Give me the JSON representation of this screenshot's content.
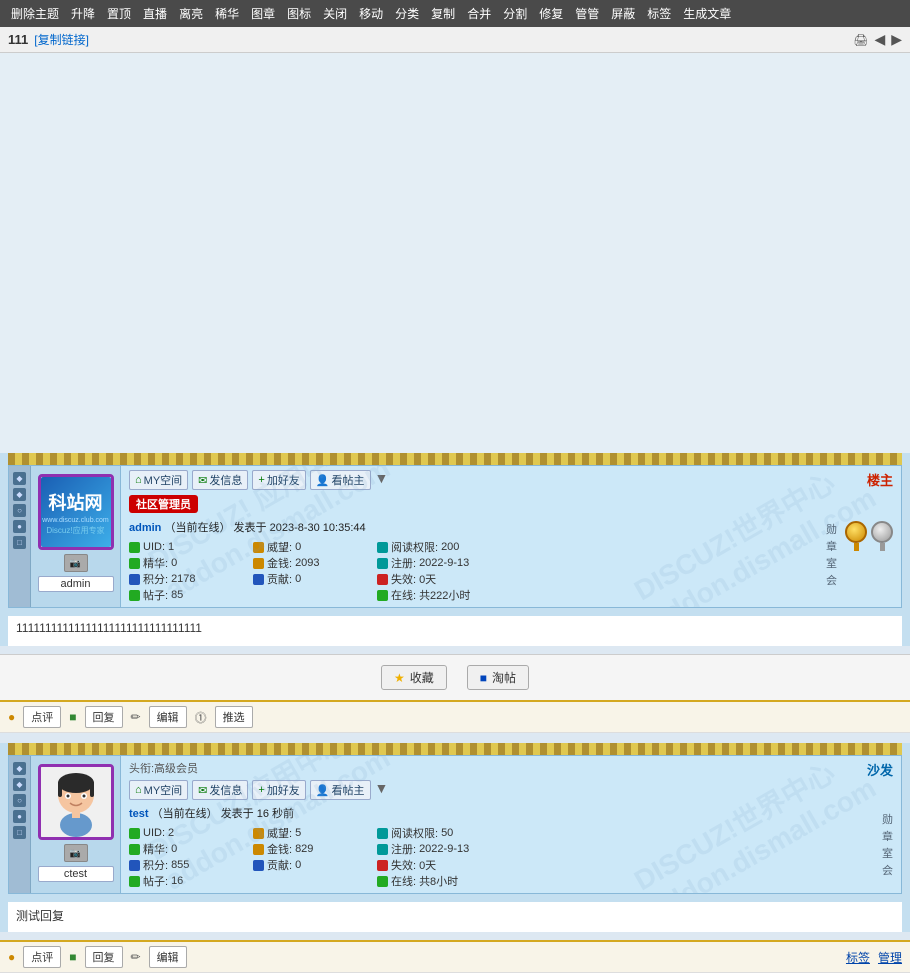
{
  "topMenu": {
    "items": [
      "删除主题",
      "升降",
      "置顶",
      "直播",
      "离亮",
      "稀华",
      "图章",
      "图标",
      "关闭",
      "移动",
      "分类",
      "复制",
      "合并",
      "分割",
      "修复",
      "管管",
      "屏蔽",
      "标签",
      "生成文章"
    ]
  },
  "threadHeader": {
    "id": "111",
    "copyLink": "复制链接",
    "printTitle": "打印",
    "prevTitle": "上一篇",
    "nextTitle": "下一篇"
  },
  "post1": {
    "roleBadge": "楼主",
    "titleBadge": "社区管理员",
    "author": "admin",
    "onlineStatus": "当前在线",
    "postTime": "2023-8-30 10:35:44",
    "uid": "1",
    "prestige": "0",
    "jinghua": "0",
    "points": "2178",
    "posts": "85",
    "gold": "2093",
    "contribution": "0",
    "readPerm": "200",
    "regDate": "2022-9-13",
    "missedDays": "0天",
    "onlineHours": "共222小时",
    "nickname": "admin",
    "headTitle": "",
    "actions": {
      "mySpace": "MY空间",
      "sendMsg": "发信息",
      "addFriend": "加好友",
      "viewProfile": "看帖主"
    },
    "content": "11111111111111111111111111111111"
  },
  "post2": {
    "roleBadge": "沙发",
    "headTitle": "头衔:高级会员",
    "author": "test",
    "onlineStatus": "当前在线",
    "postTimeRelative": "16 秒前",
    "uid": "2",
    "prestige": "5",
    "jinghua": "0",
    "points": "855",
    "posts": "16",
    "gold": "829",
    "contribution": "0",
    "readPerm": "50",
    "regDate": "2022-9-13",
    "missedDays": "0天",
    "onlineHours": "共8小时",
    "nickname": "ctest",
    "actions": {
      "mySpace": "MY空间",
      "sendMsg": "发信息",
      "addFriend": "加好友",
      "viewProfile": "看帖主"
    },
    "content": "测试回复"
  },
  "bottomActions": {
    "collect": "收藏",
    "savePost": "淘帖"
  },
  "footerActions1": {
    "comment": "点评",
    "reply": "回复",
    "edit": "编辑",
    "recommend": "推选"
  },
  "footerActions2": {
    "comment": "点评",
    "reply": "回复",
    "edit": "编辑"
  },
  "pageBottom": {
    "left": "",
    "right": "标签  管理"
  },
  "stats": {
    "uid_label": "UID:",
    "prestige_label": "威望:",
    "jinghua_label": "精华:",
    "points_label": "积分:",
    "posts_label": "帖子:",
    "gold_label": "金钱:",
    "contribution_label": "贡献:",
    "readPerm_label": "阅读权限:",
    "regDate_label": "注册:",
    "missedDays_label": "失效:",
    "onlineHours_label": "在线:"
  }
}
